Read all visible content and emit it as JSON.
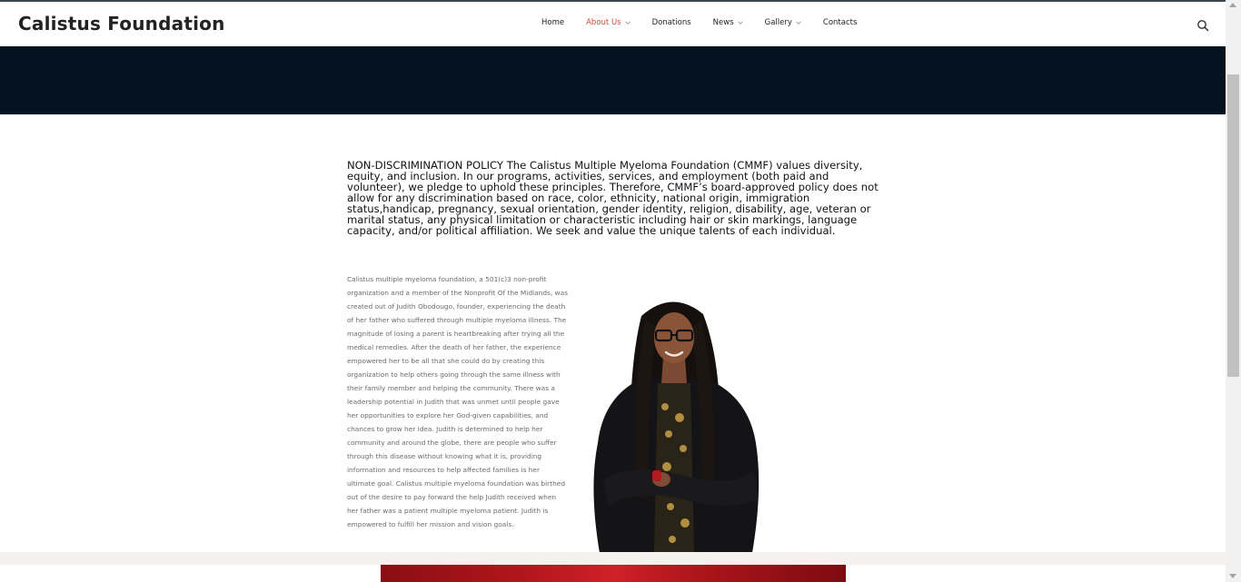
{
  "site": {
    "brand": "Calistus Foundation"
  },
  "nav": {
    "items": [
      {
        "label": "Home",
        "has_dropdown": false,
        "active": false
      },
      {
        "label": "About Us",
        "has_dropdown": true,
        "active": true
      },
      {
        "label": "Donations",
        "has_dropdown": false,
        "active": false
      },
      {
        "label": "News",
        "has_dropdown": true,
        "active": false
      },
      {
        "label": "Gallery",
        "has_dropdown": true,
        "active": false
      },
      {
        "label": "Contacts",
        "has_dropdown": false,
        "active": false
      }
    ],
    "search_icon": "search-icon",
    "active_color": "#d84a3a"
  },
  "content": {
    "policy": "NON-DISCRIMINATION POLICY The Calistus Multiple Myeloma Foundation (CMMF) values diversity, equity, and inclusion. In our programs, activities, services, and employment (both paid and volunteer), we pledge to uphold these principles. Therefore, CMMF’s board-approved policy does not allow for any discrimination based on race, color, ethnicity, national origin, immigration status,handicap, pregnancy, sexual orientation, gender identity, religion, disability, age, veteran or marital status, any physical limitation or characteristic including hair or skin markings, language capacity, and/or political affiliation. We seek and value the unique talents of each individual.",
    "bio": "Calistus multiple myeloma foundation, a 501(c)3 non-profit organization and a member of the Nonprofit Of the Midlands,  was created out of Judith Obodougo, founder, experiencing the death of her father who suffered through multiple myeloma illness. The magnitude of losing a parent is heartbreaking after trying all the medical remedies. After the death of her father, the experience empowered her to be all that she could do by creating this organization to help others going through the same illness with their family member and helping the community. There was a leadership potential in Judith that was unmet until people gave her opportunities to explore her God-given capabilities, and chances to grow her idea. Judith is determined to help her community and around the globe, there are people who suffer through this disease without knowing what it is, providing information and resources to help affected families is her ultimate goal.  Calistus multiple myeloma foundation was birthed out of the desire to pay forward the help Judith received when her father was a patient multiple myeloma patient. Judith is empowered to fulfill her mission and vision goals."
  },
  "colors": {
    "hero_band": "#04111f",
    "body_text": "#6b6b6b"
  }
}
